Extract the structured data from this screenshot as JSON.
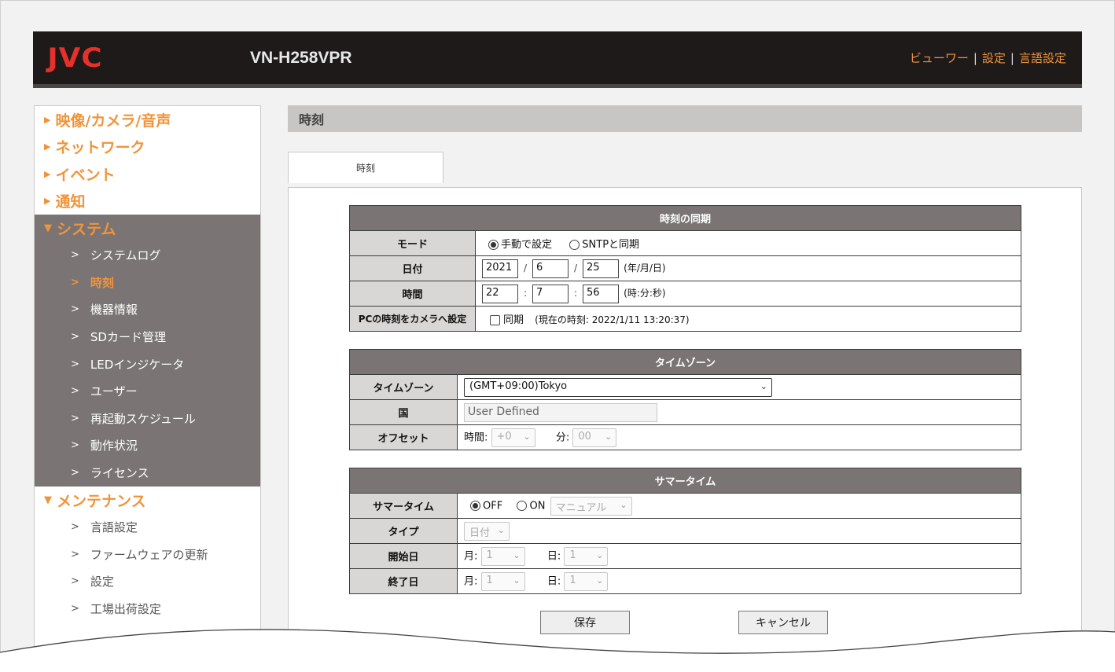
{
  "header": {
    "logo": "JVC",
    "model": "VN-H258VPR",
    "links": [
      "ビューワー",
      "設定",
      "言語設定"
    ]
  },
  "sidebar": {
    "categories": [
      {
        "label": "映像/カメラ/音声"
      },
      {
        "label": "ネットワーク"
      },
      {
        "label": "イベント"
      },
      {
        "label": "通知"
      }
    ],
    "system": {
      "label": "システム",
      "items": [
        "システムログ",
        "時刻",
        "機器情報",
        "SDカード管理",
        "LEDインジケータ",
        "ユーザー",
        "再起動スケジュール",
        "動作状況",
        "ライセンス"
      ],
      "active": "時刻"
    },
    "maintenance": {
      "label": "メンテナンス",
      "items": [
        "言語設定",
        "ファームウェアの更新",
        "設定",
        "工場出荷設定"
      ]
    }
  },
  "page": {
    "title": "時刻",
    "tab": "時刻"
  },
  "sync": {
    "header": "時刻の同期",
    "mode_label": "モード",
    "mode_manual": "手動で設定",
    "mode_sntp": "SNTPと同期",
    "date_label": "日付",
    "year": "2021",
    "month": "6",
    "day": "25",
    "date_unit": "(年/月/日)",
    "time_label": "時間",
    "hour": "22",
    "minute": "7",
    "second": "56",
    "time_unit": "(時:分:秒)",
    "pc_label": "PCの時刻をカメラへ設定",
    "pc_sync": "同期",
    "current_time": "(現在の時刻: 2022/1/11 13:20:37)"
  },
  "timezone": {
    "header": "タイムゾーン",
    "tz_label": "タイムゾーン",
    "tz_value": "(GMT+09:00)Tokyo",
    "country_label": "国",
    "country_value": "User Defined",
    "offset_label": "オフセット",
    "offset_hour_label": "時間:",
    "offset_hour": "+0",
    "offset_min_label": "分:",
    "offset_min": "00"
  },
  "summer": {
    "header": "サマータイム",
    "st_label": "サマータイム",
    "off": "OFF",
    "on": "ON",
    "mode": "マニュアル",
    "type_label": "タイプ",
    "type_value": "日付",
    "start_label": "開始日",
    "end_label": "終了日",
    "month_label": "月:",
    "day_label": "日:",
    "start_month": "1",
    "start_day": "1",
    "end_month": "1",
    "end_day": "1"
  },
  "buttons": {
    "save": "保存",
    "cancel": "キャンセル"
  }
}
